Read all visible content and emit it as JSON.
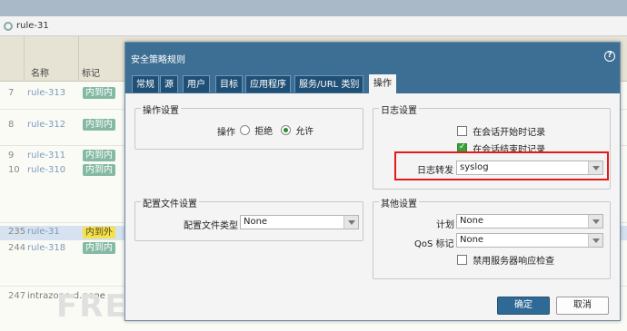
{
  "search": {
    "value": "rule-31"
  },
  "grid": {
    "headers": {
      "name": "名称",
      "tag": "标记"
    },
    "rows": [
      {
        "num": "7",
        "name": "rule-313",
        "tag": "内到内",
        "style": "tag"
      },
      {
        "num": "8",
        "name": "rule-312",
        "tag": "内到内",
        "style": "tag"
      },
      {
        "num": "9",
        "name": "rule-311",
        "tag": "内到内",
        "style": "tag"
      },
      {
        "num": "10",
        "name": "rule-310",
        "tag": "内到内",
        "style": "tag"
      },
      {
        "num": "235",
        "name": "rule-31",
        "tag": "内到外",
        "style": "warn"
      },
      {
        "num": "244",
        "name": "rule-318",
        "tag": "内到内",
        "style": "tag"
      },
      {
        "num": "247",
        "name": "intrazone-d...",
        "tag": "none",
        "style": "plain"
      }
    ]
  },
  "watermark": "FREEBUF",
  "dialog": {
    "title": "安全策略规则",
    "tabs": [
      "常规",
      "源",
      "用户",
      "目标",
      "应用程序",
      "服务/URL 类别",
      "操作"
    ],
    "action_settings": {
      "title": "操作设置",
      "label": "操作",
      "options": [
        "拒绝",
        "允许"
      ],
      "selected": "允许"
    },
    "log_settings": {
      "title": "日志设置",
      "log_start": {
        "label": "在会话开始时记录",
        "checked": false
      },
      "log_end": {
        "label": "在会话结束时记录",
        "checked": true
      },
      "log_forward_label": "日志转发",
      "log_forward_value": "syslog"
    },
    "profile_settings": {
      "title": "配置文件设置",
      "label": "配置文件类型",
      "value": "None"
    },
    "other_settings": {
      "title": "其他设置",
      "schedule_label": "计划",
      "schedule_value": "None",
      "qos_label": "QoS 标记",
      "qos_value": "None",
      "disable_inspect_label": "禁用服务器响应检查",
      "disable_inspect_checked": false
    },
    "buttons": {
      "ok": "确定",
      "cancel": "取消"
    }
  },
  "colors": {
    "accent": "#3d6e94",
    "highlight_border": "#e21a1a",
    "tag": "#84b9a4"
  }
}
